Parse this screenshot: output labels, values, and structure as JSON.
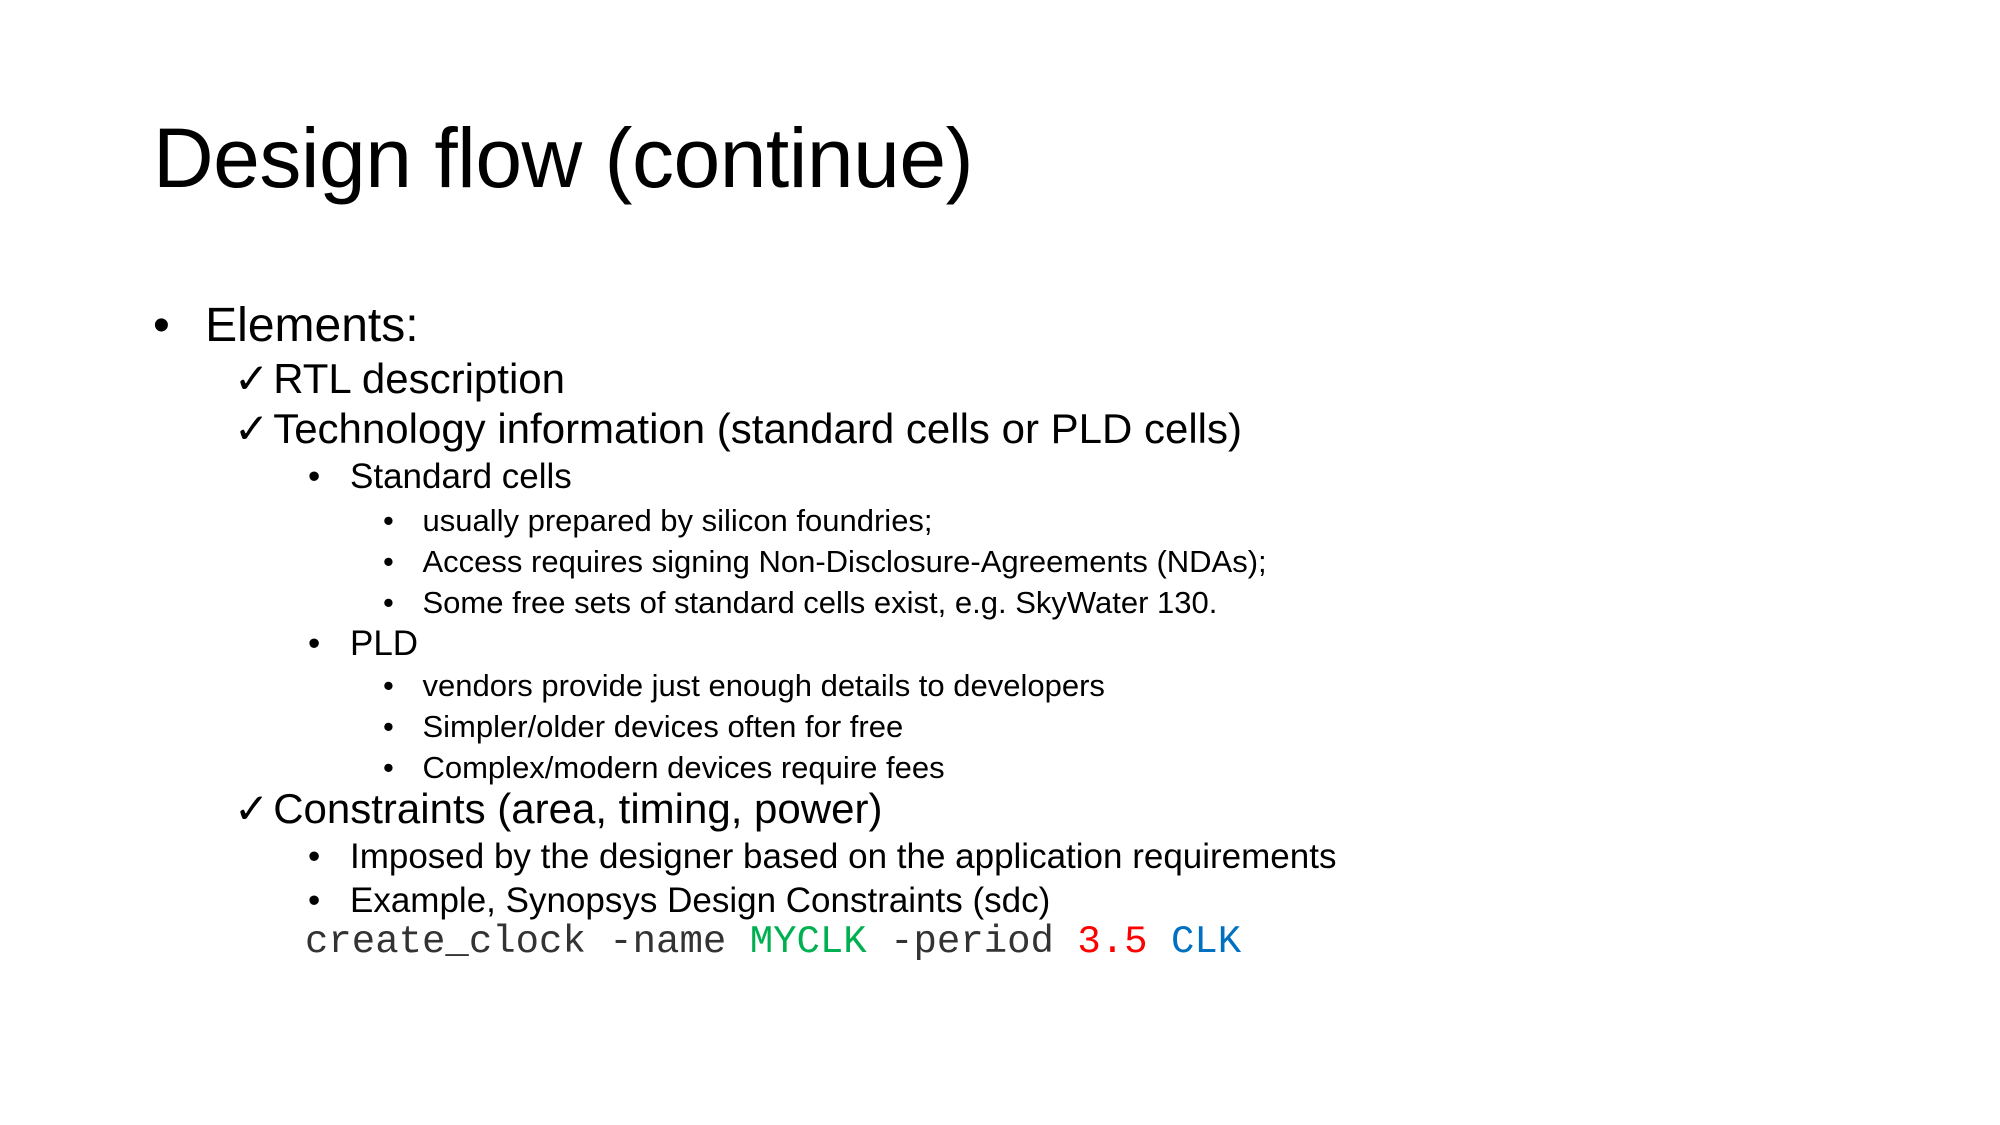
{
  "title": "Design flow (continue)",
  "bullet_glyph": "•",
  "check_glyph": "✓",
  "items": {
    "elements": "Elements:",
    "rtl": "RTL description",
    "tech": "Technology information (standard cells or PLD cells)",
    "std_cells": "Standard cells",
    "std_1": "usually prepared by silicon foundries;",
    "std_2": "Access requires signing Non-Disclosure-Agreements (NDAs);",
    "std_3": "Some free sets of standard cells exist, e.g. SkyWater 130.",
    "pld": "PLD",
    "pld_1": "vendors provide just enough details to developers",
    "pld_2": "Simpler/older devices often for free",
    "pld_3": "Complex/modern devices require fees",
    "constraints": "Constraints (area, timing, power)",
    "con_1": "Imposed by the designer based on the application requirements",
    "con_2": "Example, Synopsys Design Constraints (sdc)"
  },
  "code": {
    "cmd": "create_clock -name ",
    "name": "MYCLK",
    "period_flag": " -period ",
    "period": "3.5",
    "clock": "CLK"
  },
  "colors": {
    "code_text": "#333333",
    "code_name": "#00b050",
    "code_period": "#ff0000",
    "code_clock": "#0070c0"
  }
}
